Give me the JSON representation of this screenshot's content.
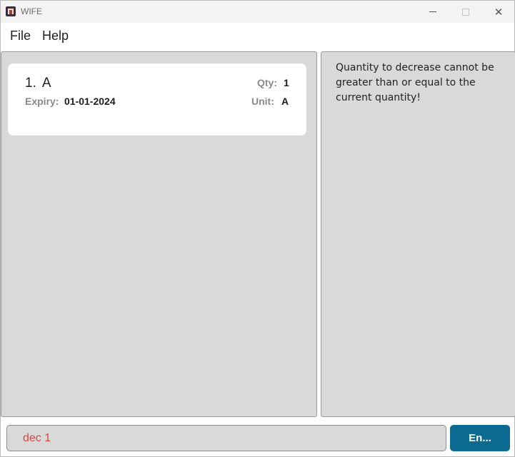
{
  "window": {
    "title": "WIFE",
    "icon": "wife-app-icon"
  },
  "controls": {
    "minimize_icon": "minimize-icon",
    "maximize_icon": "maximize-icon",
    "close_icon": "close-icon",
    "close_glyph": "✕"
  },
  "menu": {
    "file": "File",
    "help": "Help"
  },
  "items": [
    {
      "index": "1.",
      "name": "A",
      "expiry_label": "Expiry:",
      "expiry": "01-01-2024",
      "qty_label": "Qty:",
      "qty": "1",
      "unit_label": "Unit:",
      "unit": "A"
    }
  ],
  "result": {
    "message": "Quantity to decrease cannot be greater than or equal to the current quantity!"
  },
  "command": {
    "input_value": "dec 1",
    "enter_label": "En..."
  },
  "colors": {
    "accent": "#0a6a90",
    "error_text": "#d24a3f",
    "pane_bg": "#d9d9d9"
  }
}
